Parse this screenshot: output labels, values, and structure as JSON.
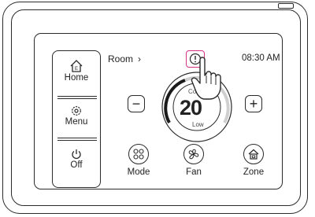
{
  "sidebar": {
    "items": [
      {
        "label": "Home",
        "icon": "home-icon"
      },
      {
        "label": "Menu",
        "icon": "gear-icon"
      },
      {
        "label": "Off",
        "icon": "power-icon"
      }
    ]
  },
  "header": {
    "room_label": "Room",
    "time": "08:30 AM"
  },
  "thermostat": {
    "temperature": "20",
    "mode_text": "Cool",
    "fan_text": "Low",
    "decrease_label": "−",
    "increase_label": "+"
  },
  "bottom_bar": {
    "items": [
      {
        "label": "Mode",
        "icon": "mode-grid-icon"
      },
      {
        "label": "Fan",
        "icon": "fan-icon"
      },
      {
        "label": "Zone",
        "icon": "zone-home-icon"
      }
    ]
  },
  "colors": {
    "highlight": "#d63384",
    "stroke": "#2a2a2a",
    "arc_dark": "#1a1a1a",
    "arc_light": "#cfcfcf"
  }
}
